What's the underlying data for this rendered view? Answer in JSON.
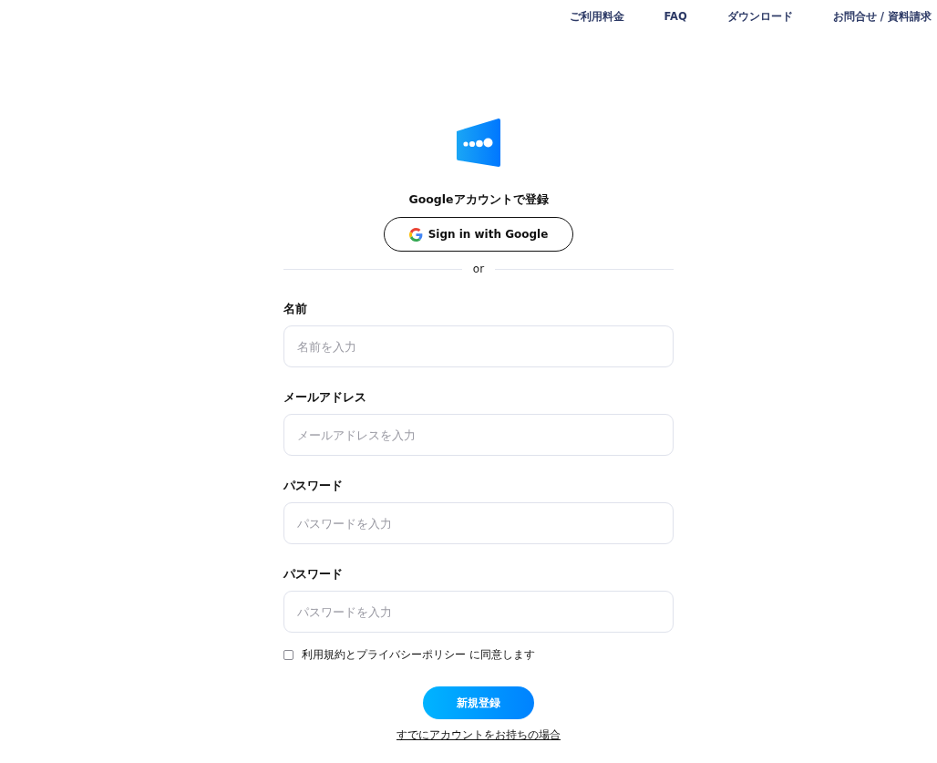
{
  "nav": [
    "ご利用料金",
    "FAQ",
    "ダウンロード",
    "お問合せ / 資料請求"
  ],
  "google": {
    "heading": "Googleアカウントで登録",
    "button": "Sign in with Google"
  },
  "divider": "or",
  "fields": [
    {
      "label": "名前",
      "placeholder": "名前を入力"
    },
    {
      "label": "メールアドレス",
      "placeholder": "メールアドレスを入力"
    },
    {
      "label": "パスワード",
      "placeholder": "パスワードを入力"
    },
    {
      "label": "パスワード",
      "placeholder": "パスワードを入力"
    }
  ],
  "agree": {
    "label": "利用規約とプライバシーポリシー に同意します",
    "checked": false
  },
  "submit": "新規登録",
  "login_link": "すでにアカウントをお持ちの場合"
}
